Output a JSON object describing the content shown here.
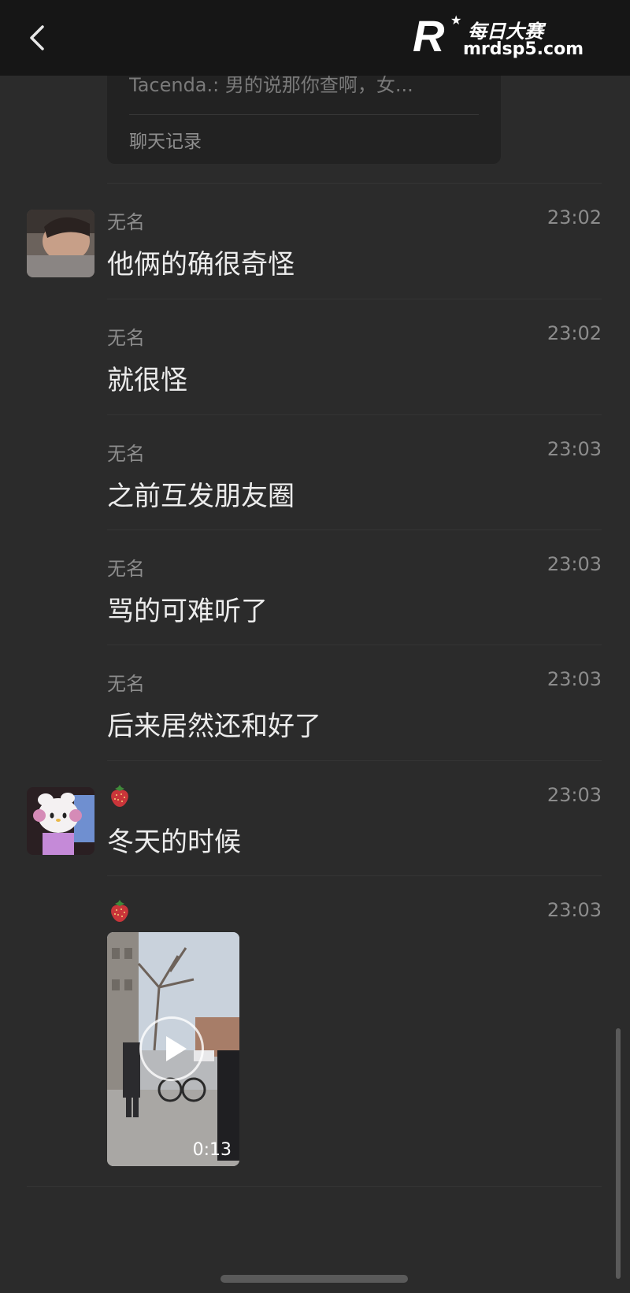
{
  "header": {
    "back_icon": "chevron-left-icon"
  },
  "watermark": {
    "logo_letter": "R",
    "brand": "每日大赛",
    "url": "mrdsp5.com"
  },
  "quote_card": {
    "preview": "Tacenda.: 男的说那你查啊，女...",
    "label": "聊天记录"
  },
  "messages": [
    {
      "name": "无名",
      "time": "23:02",
      "text": "他俩的确很奇怪"
    },
    {
      "name": "无名",
      "time": "23:02",
      "text": "就很怪"
    },
    {
      "name": "无名",
      "time": "23:03",
      "text": "之前互发朋友圈"
    },
    {
      "name": "无名",
      "time": "23:03",
      "text": "骂的可难听了"
    },
    {
      "name": "无名",
      "time": "23:03",
      "text": "后来居然还和好了"
    },
    {
      "name_icon": "strawberry-icon",
      "time": "23:03",
      "text": "冬天的时候"
    },
    {
      "name_icon": "strawberry-icon",
      "time": "23:03",
      "video_duration": "0:13"
    }
  ],
  "colors": {
    "background": "#2b2b2b",
    "topbar": "#161616",
    "text": "#ececec",
    "meta": "#8c8c8c"
  }
}
